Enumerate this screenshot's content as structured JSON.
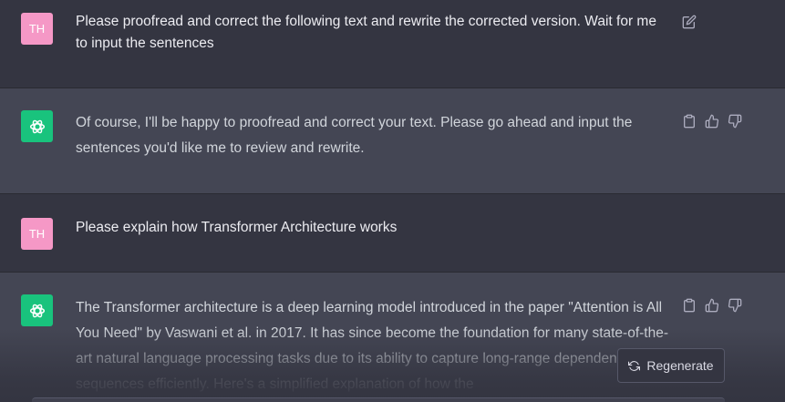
{
  "conversation": {
    "messages": [
      {
        "role": "user",
        "avatar_text": "TH",
        "text": "Please proofread and correct the following text and rewrite the corrected version. Wait for me to input the sentences"
      },
      {
        "role": "assistant",
        "text": "Of course, I'll be happy to proofread and correct your text. Please go ahead and input the sentences you'd like me to review and rewrite."
      },
      {
        "role": "user",
        "avatar_text": "TH",
        "text": "Please explain how Transformer Architecture works"
      },
      {
        "role": "assistant",
        "text": "The Transformer architecture is a deep learning model introduced in the paper \"Attention is All You Need\" by Vaswani et al. in 2017. It has since become the foundation for many state-of-the-art natural language processing tasks due to its ability to capture long-range dependencies in sequences efficiently. Here's a simplified explanation of how the"
      }
    ]
  },
  "icons": {
    "edit": "edit-icon",
    "copy": "clipboard-icon",
    "like": "thumbs-up-icon",
    "dislike": "thumbs-down-icon",
    "regenerate": "refresh-icon",
    "assistant_avatar": "openai-logo-icon"
  },
  "controls": {
    "regenerate_label": "Regenerate"
  },
  "colors": {
    "user_row_bg": "#343541",
    "assistant_row_bg": "#444654",
    "user_avatar_bg": "#f598c6",
    "assistant_avatar_bg": "#19c37d"
  }
}
